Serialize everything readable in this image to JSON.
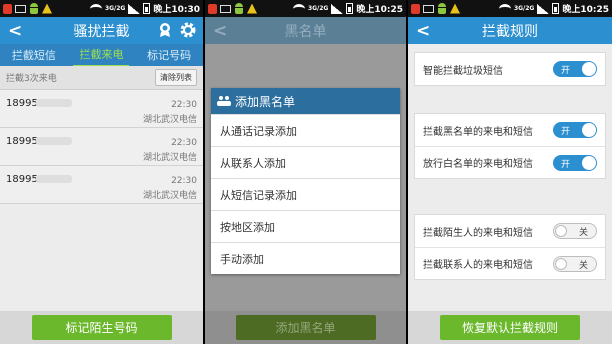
{
  "status_bars": [
    {
      "time": "晚上10:30",
      "net": "3G/2G"
    },
    {
      "time": "晚上10:25",
      "net": "3G/2G"
    },
    {
      "time": "晚上10:25",
      "net": "3G/2G"
    }
  ],
  "screen1": {
    "back": "<",
    "title": "骚扰拦截",
    "tabs": [
      "拦截短信",
      "拦截来电",
      "标记号码"
    ],
    "subheader": "拦截3次来电",
    "clear_button": "清除列表",
    "calls": [
      {
        "number": "18995",
        "time": "22:30",
        "location": "湖北武汉电信"
      },
      {
        "number": "18995",
        "time": "22:30",
        "location": "湖北武汉电信"
      },
      {
        "number": "18995",
        "time": "22:30",
        "location": "湖北武汉电信"
      }
    ],
    "bottom_button": "标记陌生号码"
  },
  "screen2": {
    "back": "<",
    "title": "黑名单",
    "dialog_title": "添加黑名单",
    "dialog_items": [
      "从通话记录添加",
      "从联系人添加",
      "从短信记录添加",
      "按地区添加",
      "手动添加"
    ],
    "bottom_button": "添加黑名单"
  },
  "screen3": {
    "back": "<",
    "title": "拦截规则",
    "groups": [
      [
        {
          "label": "智能拦截垃圾短信",
          "state": "开"
        }
      ],
      [
        {
          "label": "拦截黑名单的来电和短信",
          "state": "开"
        },
        {
          "label": "放行白名单的来电和短信",
          "state": "开"
        }
      ],
      [
        {
          "label": "拦截陌生人的来电和短信",
          "state": "关"
        },
        {
          "label": "拦截联系人的来电和短信",
          "state": "关"
        }
      ]
    ],
    "bottom_button": "恢复默认拦截规则"
  },
  "colors": {
    "accent": "#2c8fcf",
    "green": "#6bb82c",
    "tab_active": "#9fe04e"
  }
}
